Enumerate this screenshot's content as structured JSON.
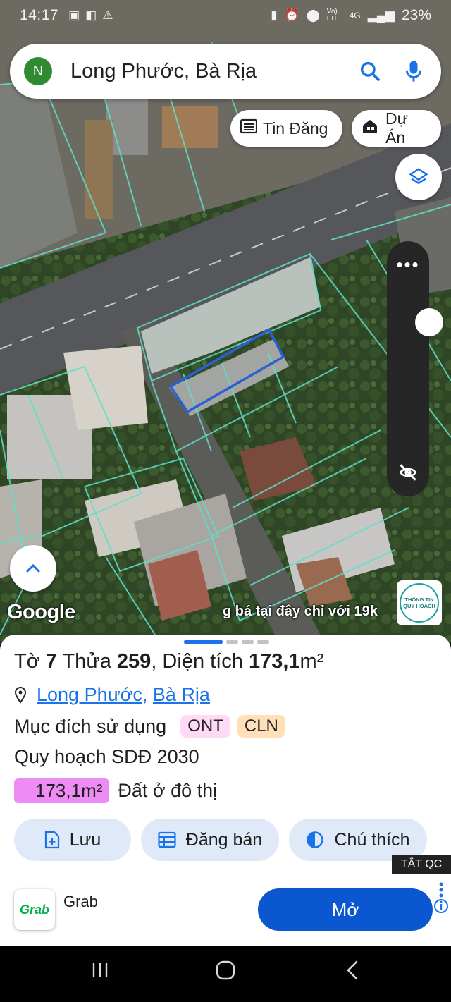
{
  "status_bar": {
    "time": "14:17",
    "network": "Vo) LTE",
    "signal_label": "4G",
    "battery": "23%"
  },
  "search": {
    "avatar_letter": "N",
    "query": "Long Phước, Bà Rịa"
  },
  "chips": {
    "listings": "Tin Đăng",
    "projects": "Dự Án"
  },
  "map": {
    "google_label": "Google",
    "ticker": "g bá tại đây chỉ với 19k",
    "badge_text": "THÔNG TIN QUY HOẠCH"
  },
  "parcel": {
    "title_prefix": "Tờ ",
    "sheet_no": "7",
    "title_mid": " Thửa ",
    "parcel_no": "259",
    "title_area_label": ", Diện tích ",
    "area_value": "173,1",
    "area_unit": "m²",
    "location_ward": "Long Phước",
    "location_sep": ",",
    "location_city": "Bà Rịa",
    "purpose_label": "Mục đích sử dụng",
    "tags": [
      "ONT",
      "CLN"
    ],
    "plan_label": "Quy hoạch SDĐ 2030",
    "plan_area": "173,1m²",
    "plan_type": "Đất ở đô thị"
  },
  "actions": {
    "save": "Lưu",
    "post_sale": "Đăng bán",
    "legend": "Chú thích"
  },
  "ad": {
    "close_label": "TẮT QC",
    "brand_logo": "Grab",
    "name": "Grab",
    "open": "Mở"
  },
  "colors": {
    "accent": "#1a73e8",
    "plan_badge": "#ef8bf5",
    "tag_ont": "#ffdaf4",
    "tag_cln": "#ffe0b8",
    "parcel_outline": "#5ee0c8",
    "selected_parcel": "#2a5fd6"
  }
}
